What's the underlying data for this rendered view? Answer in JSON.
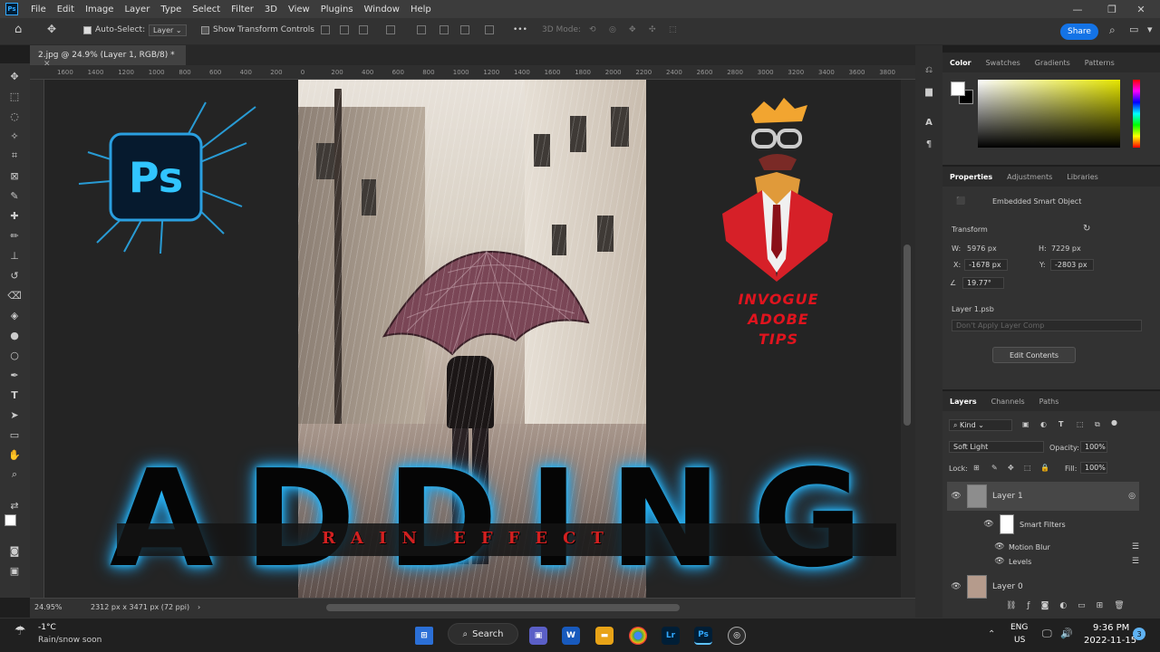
{
  "menu": {
    "items": [
      "File",
      "Edit",
      "Image",
      "Layer",
      "Type",
      "Select",
      "Filter",
      "3D",
      "View",
      "Plugins",
      "Window",
      "Help"
    ]
  },
  "options_bar": {
    "auto_select_label": "Auto-Select:",
    "auto_select_value": "Layer",
    "show_transform_label": "Show Transform Controls",
    "more_label": "•••",
    "mode_label": "3D Mode:",
    "share_label": "Share"
  },
  "document": {
    "tab_title": "2.jpg @ 24.9% (Layer 1, RGB/8) *",
    "zoom": "24.95%",
    "dimensions": "2312 px x 3471 px (72 ppi)"
  },
  "ruler": {
    "h_ticks": [
      "1600",
      "1400",
      "1200",
      "1000",
      "800",
      "600",
      "400",
      "200",
      "0",
      "200",
      "400",
      "600",
      "800",
      "1000",
      "1200",
      "1400",
      "1600",
      "1800",
      "2000",
      "2200",
      "2400",
      "2600",
      "2800",
      "3000",
      "3200",
      "3400",
      "3600",
      "3800"
    ]
  },
  "canvas_text": {
    "headline": "ADDING",
    "subline": "RAIN EFFECT",
    "logo_lines": [
      "INVOGUE",
      "ADOBE",
      "TIPS"
    ],
    "ps_logo": "Ps"
  },
  "color_panel": {
    "tabs": [
      "Color",
      "Swatches",
      "Gradients",
      "Patterns"
    ],
    "fg_color": "#ffffff",
    "bg_color": "#000000"
  },
  "properties_panel": {
    "tabs": [
      "Properties",
      "Adjustments",
      "Libraries"
    ],
    "type_label": "Embedded Smart Object",
    "transform_label": "Transform",
    "w_label": "W:",
    "w_value": "5976 px",
    "h_label": "H:",
    "h_value": "7229 px",
    "x_label": "X:",
    "x_value": "-1678 px",
    "y_label": "Y:",
    "y_value": "-2803 px",
    "angle_value": "19.77°",
    "file_label": "Layer 1.psb",
    "comp_placeholder": "Don't Apply Layer Comp",
    "edit_contents_label": "Edit Contents"
  },
  "layers_panel": {
    "tabs": [
      "Layers",
      "Channels",
      "Paths"
    ],
    "kind_label": "Kind",
    "blend_mode": "Soft Light",
    "opacity_label": "Opacity:",
    "opacity_value": "100%",
    "lock_label": "Lock:",
    "fill_label": "Fill:",
    "fill_value": "100%",
    "layers": [
      {
        "name": "Layer 1"
      },
      {
        "name": "Smart Filters"
      },
      {
        "name": "Motion Blur"
      },
      {
        "name": "Levels"
      },
      {
        "name": "Layer 0"
      }
    ]
  },
  "taskbar": {
    "weather_temp": "-1°C",
    "weather_desc": "Rain/snow soon",
    "search_label": "Search",
    "lang_top": "ENG",
    "lang_bottom": "US",
    "time": "9:36 PM",
    "date": "2022-11-15",
    "notif_count": "3",
    "apps": [
      "W",
      "Lr",
      "Ps"
    ]
  }
}
